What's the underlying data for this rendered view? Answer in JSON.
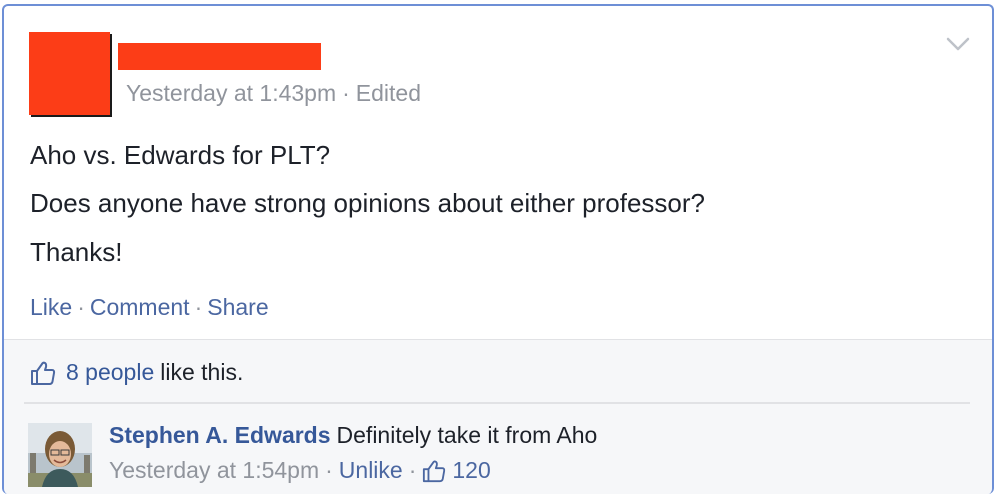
{
  "post": {
    "timestamp": "Yesterday at 1:43pm",
    "edited": "Edited",
    "separator": "·",
    "lines": [
      "Aho vs. Edwards for PLT?",
      "Does anyone have strong opinions about either professor?",
      "Thanks!"
    ]
  },
  "actions": {
    "like": "Like",
    "comment": "Comment",
    "share": "Share"
  },
  "likes": {
    "people": "8 people",
    "suffix": "like this."
  },
  "comment": {
    "author": "Stephen A. Edwards",
    "text": "Definitely take it from Aho",
    "timestamp": "Yesterday at 1:54pm",
    "unlike": "Unlike",
    "like_count": "120"
  },
  "colors": {
    "card_border": "#6d8fd6",
    "redaction": "#fc3d17",
    "link": "#4b67a1",
    "name_link": "#365899",
    "muted": "#90949c",
    "text": "#1d2129",
    "feedback_bg": "#f6f7f9"
  },
  "icons": {
    "options": "chevron-down-icon",
    "like": "thumbs-up-icon"
  }
}
